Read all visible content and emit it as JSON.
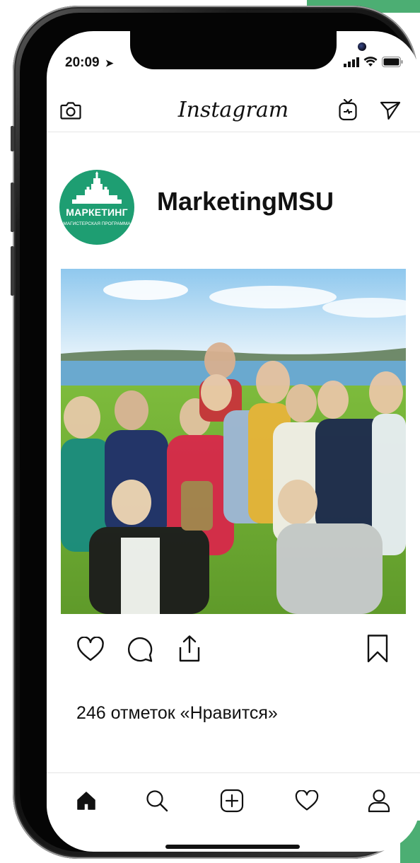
{
  "status": {
    "time": "20:09"
  },
  "app": {
    "brand": "Instagram"
  },
  "profile": {
    "username": "MarketingMSU",
    "avatar_title": "МАРКЕТИНГ",
    "avatar_subtitle": "МАГИСТЕРСКАЯ ПРОГРАММА"
  },
  "post": {
    "likes_text": "246 отметок «Нравится»"
  },
  "colors": {
    "brand_green": "#1e9e72",
    "accent_green": "#4cae73"
  },
  "icons": {
    "top_left": "camera-icon",
    "top_right": [
      "igtv-icon",
      "direct-send-icon"
    ],
    "actions": [
      "heart-icon",
      "comment-icon",
      "share-icon",
      "bookmark-icon"
    ],
    "bottom_nav": [
      "home-icon",
      "search-icon",
      "add-post-icon",
      "activity-heart-icon",
      "profile-icon"
    ]
  }
}
